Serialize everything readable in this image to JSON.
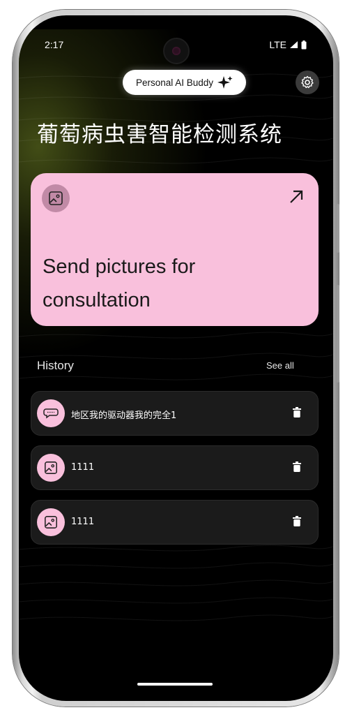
{
  "status_bar": {
    "time": "2:17",
    "network": "LTE"
  },
  "header": {
    "assistant_button_label": "Personal AI Buddy",
    "assistant_icon": "sparkle-icon",
    "settings_icon": "gear-icon"
  },
  "page": {
    "title": "葡萄病虫害智能检测系统"
  },
  "hero_card": {
    "label": "Send pictures for consultation",
    "icon": "image-icon",
    "action_icon": "arrow-up-right-icon",
    "color": "#f9c0dc"
  },
  "history": {
    "title": "History",
    "see_all_label": "See all",
    "items": [
      {
        "label": "地区我的驱动器我的完全1",
        "icon": "chat-bubble-icon"
      },
      {
        "label": "1111",
        "icon": "image-icon"
      },
      {
        "label": "1111",
        "icon": "image-icon"
      }
    ]
  },
  "colors": {
    "background": "#000000",
    "accent_pink": "#f9c0dc",
    "card_dark": "#1b1b1b"
  }
}
